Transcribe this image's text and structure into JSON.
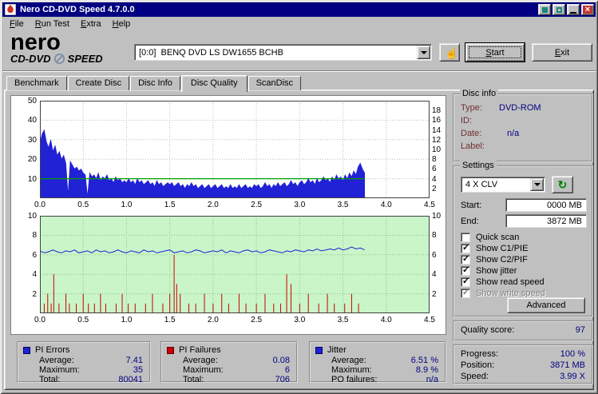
{
  "window": {
    "title": "Nero CD-DVD Speed 4.7.0.0",
    "close_glyph": "×"
  },
  "menu": {
    "items": [
      "File",
      "Run Test",
      "Extra",
      "Help"
    ]
  },
  "toolbar": {
    "logo_line1": "nero",
    "logo_line2a": "CD-DVD",
    "logo_line2b": "SPEED",
    "drive_value": "[0:0]  BENQ DVD LS DW1655 BCHB",
    "hand_glyph": "☝",
    "start_label": "Start",
    "exit_label": "Exit"
  },
  "tabs": [
    "Benchmark",
    "Create Disc",
    "Disc Info",
    "Disc Quality",
    "ScanDisc"
  ],
  "disc_info": {
    "title": "Disc info",
    "rows": [
      {
        "label": "Type:",
        "value": "DVD-ROM"
      },
      {
        "label": "ID:",
        "value": ""
      },
      {
        "label": "Date:",
        "value": "n/a"
      },
      {
        "label": "Label:",
        "value": ""
      }
    ]
  },
  "settings": {
    "title": "Settings",
    "speed_value": "4 X CLV",
    "refresh_glyph": "↻",
    "start_label": "Start:",
    "start_value": "0000 MB",
    "end_label": "End:",
    "end_value": "3872 MB",
    "checkboxes": [
      {
        "label": "Quick scan",
        "checked": false,
        "enabled": true
      },
      {
        "label": "Show C1/PIE",
        "checked": true,
        "enabled": true
      },
      {
        "label": "Show C2/PIF",
        "checked": true,
        "enabled": true
      },
      {
        "label": "Show jitter",
        "checked": true,
        "enabled": true
      },
      {
        "label": "Show read speed",
        "checked": true,
        "enabled": true
      },
      {
        "label": "Show write speed",
        "checked": true,
        "enabled": false
      }
    ],
    "advanced_label": "Advanced"
  },
  "quality": {
    "label": "Quality score:",
    "value": "97"
  },
  "progress": [
    {
      "label": "Progress:",
      "value": "100 %"
    },
    {
      "label": "Position:",
      "value": "3871 MB"
    },
    {
      "label": "Speed:",
      "value": "3.99 X"
    }
  ],
  "stats": [
    {
      "name": "PI Errors",
      "color": "#2121d6",
      "rows": [
        {
          "label": "Average:",
          "value": "7.41"
        },
        {
          "label": "Maximum:",
          "value": "35"
        },
        {
          "label": "Total:",
          "value": "80041"
        }
      ]
    },
    {
      "name": "PI Failures",
      "color": "#cc0000",
      "rows": [
        {
          "label": "Average:",
          "value": "0.08"
        },
        {
          "label": "Maximum:",
          "value": "6"
        },
        {
          "label": "Total:",
          "value": "706"
        }
      ]
    },
    {
      "name": "Jitter",
      "color": "#2121d6",
      "rows": [
        {
          "label": "Average:",
          "value": "6.51 %"
        },
        {
          "label": "Maximum:",
          "value": "8.9 %"
        },
        {
          "label": "PO failures:",
          "value": "n/a"
        }
      ]
    }
  ],
  "colors": {
    "titlebar": "#000080",
    "value_text": "#000080",
    "pi_blue": "#2121d6",
    "failure_red": "#cc0000",
    "speed_green": "#00a000",
    "jitter_plot_bg": "#c9f5c9"
  },
  "chart_data": [
    {
      "type": "area",
      "name": "PI Errors scan",
      "xlabel": "GB",
      "x_ticks": [
        "0.0",
        "0.5",
        "1.0",
        "1.5",
        "2.0",
        "2.5",
        "3.0",
        "3.5",
        "4.0",
        "4.5"
      ],
      "xlim": [
        0,
        4.5
      ],
      "left_axis": {
        "ticks": [
          10,
          20,
          30,
          40,
          50
        ],
        "max": 50
      },
      "right_axis": {
        "ticks": [
          2,
          4,
          6,
          8,
          10,
          12,
          14,
          16,
          18
        ],
        "max": 20
      },
      "series_color": "#2121d6",
      "speed_line": {
        "value": 4,
        "end_x": 3.75,
        "color": "#00a000"
      },
      "x_step": 0.025,
      "values": [
        28,
        33,
        35,
        29,
        26,
        30,
        24,
        27,
        22,
        24,
        20,
        22,
        18,
        2,
        19,
        17,
        15,
        16,
        14,
        15,
        13,
        12,
        1,
        13,
        11,
        12,
        10,
        13,
        9,
        11,
        10,
        12,
        9,
        10,
        8,
        11,
        9,
        10,
        8,
        9,
        8,
        10,
        8,
        9,
        7,
        10,
        8,
        9,
        7,
        8,
        9,
        7,
        8,
        6,
        9,
        7,
        8,
        6,
        7,
        8,
        7,
        8,
        6,
        7,
        8,
        6,
        7,
        5,
        7,
        6,
        8,
        6,
        7,
        5,
        6,
        7,
        5,
        6,
        7,
        5,
        6,
        7,
        5,
        6,
        7,
        5,
        6,
        5,
        7,
        5,
        6,
        5,
        7,
        5,
        6,
        7,
        5,
        6,
        5,
        7,
        6,
        7,
        5,
        6,
        8,
        6,
        7,
        5,
        7,
        6,
        8,
        6,
        7,
        8,
        6,
        7,
        9,
        7,
        8,
        6,
        8,
        9,
        7,
        8,
        10,
        8,
        9,
        7,
        10,
        8,
        9,
        11,
        9,
        10,
        8,
        11,
        9,
        12,
        10,
        11,
        9,
        12,
        10,
        13,
        11,
        14,
        12,
        16,
        18,
        15,
        13
      ]
    },
    {
      "type": "mixed",
      "name": "PI Failures and Jitter scan",
      "bg": "#c9f5c9",
      "x_ticks": [
        "0.0",
        "0.5",
        "1.0",
        "1.5",
        "2.0",
        "2.5",
        "3.0",
        "3.5",
        "4.0",
        "4.5"
      ],
      "xlim": [
        0,
        4.5
      ],
      "axis": {
        "ticks": [
          2,
          4,
          6,
          8,
          10
        ],
        "max": 10
      },
      "jitter": {
        "color": "#2121d6",
        "x_step": 0.05,
        "values": [
          6.4,
          6.2,
          6.3,
          6.5,
          6.3,
          6.2,
          6.4,
          6.3,
          6.5,
          6.2,
          6.3,
          6.4,
          6.2,
          6.5,
          6.3,
          6.4,
          6.2,
          6.3,
          6.5,
          6.3,
          6.2,
          6.4,
          6.3,
          6.2,
          6.5,
          6.3,
          6.4,
          6.2,
          6.3,
          6.4,
          6.5,
          6.2,
          6.3,
          6.4,
          6.2,
          6.3,
          6.5,
          6.4,
          6.2,
          6.3,
          6.4,
          6.3,
          6.5,
          6.2,
          6.4,
          6.3,
          6.2,
          6.4,
          6.5,
          6.3,
          6.4,
          6.2,
          6.3,
          6.5,
          6.4,
          6.3,
          6.2,
          6.4,
          6.3,
          6.5,
          6.4,
          6.3,
          6.5,
          6.4,
          6.6,
          6.4,
          6.5,
          6.6,
          6.5,
          6.7,
          6.5,
          6.6,
          6.8,
          6.6,
          6.7,
          6.5
        ]
      },
      "failures": {
        "color": "#cc0000",
        "points": [
          [
            0.05,
            1
          ],
          [
            0.09,
            2
          ],
          [
            0.13,
            1
          ],
          [
            0.16,
            4
          ],
          [
            0.22,
            1
          ],
          [
            0.3,
            2
          ],
          [
            0.34,
            1
          ],
          [
            0.42,
            1
          ],
          [
            0.5,
            2
          ],
          [
            0.56,
            1
          ],
          [
            0.63,
            1
          ],
          [
            0.7,
            2
          ],
          [
            0.76,
            1
          ],
          [
            0.88,
            1
          ],
          [
            0.95,
            2
          ],
          [
            1.02,
            1
          ],
          [
            1.1,
            1
          ],
          [
            1.22,
            1
          ],
          [
            1.3,
            2
          ],
          [
            1.42,
            1
          ],
          [
            1.5,
            2
          ],
          [
            1.55,
            6
          ],
          [
            1.58,
            3
          ],
          [
            1.62,
            2
          ],
          [
            1.72,
            1
          ],
          [
            1.8,
            1
          ],
          [
            1.9,
            2
          ],
          [
            2.0,
            1
          ],
          [
            2.1,
            2
          ],
          [
            2.18,
            1
          ],
          [
            2.3,
            2
          ],
          [
            2.38,
            1
          ],
          [
            2.5,
            1
          ],
          [
            2.6,
            2
          ],
          [
            2.7,
            1
          ],
          [
            2.78,
            1
          ],
          [
            2.85,
            4
          ],
          [
            2.9,
            3
          ],
          [
            3.0,
            1
          ],
          [
            3.1,
            2
          ],
          [
            3.22,
            1
          ],
          [
            3.32,
            2
          ],
          [
            3.4,
            1
          ],
          [
            3.52,
            1
          ],
          [
            3.6,
            2
          ],
          [
            3.68,
            1
          ]
        ]
      }
    }
  ]
}
